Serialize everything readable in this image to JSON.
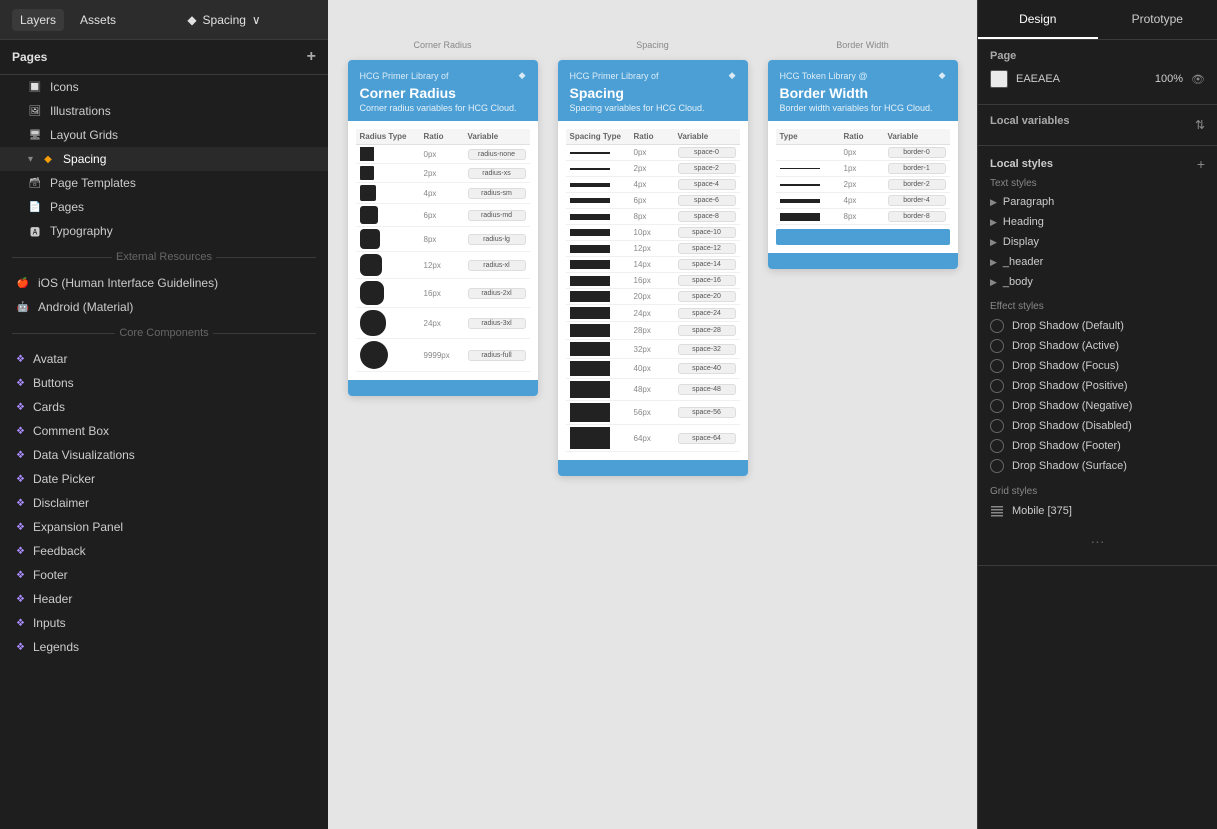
{
  "topbar": {
    "layers_tab": "Layers",
    "assets_tab": "Assets",
    "page_name": "Spacing",
    "page_indicator": "◆"
  },
  "pages_panel": {
    "title": "Pages",
    "add_icon": "+",
    "items": [
      {
        "id": "icons",
        "label": "Icons",
        "indent": 1,
        "icon": "🔲",
        "type": "page"
      },
      {
        "id": "illustrations",
        "label": "Illustrations",
        "indent": 1,
        "icon": "🖼",
        "type": "page"
      },
      {
        "id": "layout-grids",
        "label": "Layout Grids",
        "indent": 1,
        "icon": "🖥",
        "type": "page"
      },
      {
        "id": "spacing",
        "label": "Spacing",
        "indent": 1,
        "icon": "🔶",
        "type": "page",
        "active": true
      },
      {
        "id": "page-templates",
        "label": "Page Templates",
        "indent": 1,
        "icon": "🗃",
        "type": "page"
      },
      {
        "id": "pages",
        "label": "Pages",
        "indent": 1,
        "icon": "📄",
        "type": "page"
      },
      {
        "id": "typography",
        "label": "Typography",
        "indent": 1,
        "icon": "🅰",
        "type": "page"
      }
    ],
    "separator_external": "External Resources",
    "external_items": [
      {
        "id": "ios",
        "label": "iOS (Human Interface Guidelines)",
        "icon": "🍎"
      },
      {
        "id": "android",
        "label": "Android (Material)",
        "icon": "🤖"
      }
    ],
    "separator_core": "Core Components",
    "core_items": [
      {
        "id": "avatar",
        "label": "Avatar"
      },
      {
        "id": "buttons",
        "label": "Buttons"
      },
      {
        "id": "cards",
        "label": "Cards"
      },
      {
        "id": "comment-box",
        "label": "Comment Box"
      },
      {
        "id": "data-visualizations",
        "label": "Data Visualizations"
      },
      {
        "id": "date-picker",
        "label": "Date Picker"
      },
      {
        "id": "disclaimer",
        "label": "Disclaimer"
      },
      {
        "id": "expansion-panel",
        "label": "Expansion Panel"
      },
      {
        "id": "feedback",
        "label": "Feedback"
      },
      {
        "id": "footer",
        "label": "Footer"
      },
      {
        "id": "header",
        "label": "Header"
      },
      {
        "id": "inputs",
        "label": "Inputs"
      },
      {
        "id": "legends",
        "label": "Legends"
      }
    ]
  },
  "canvas": {
    "cards": [
      {
        "id": "corner-radius",
        "title": "Corner Radius",
        "brand": "HCG Primer Library of",
        "subtitle": "Corner radius variables for HCG Cloud.",
        "badge": "◆",
        "column_headers": [
          "Radius Type",
          "Ratio",
          "Variable"
        ],
        "rows": [
          {
            "swatch_size": 2,
            "label": "0px",
            "value": "radius-none"
          },
          {
            "swatch_size": 2,
            "label": "2px",
            "value": "radius-xs"
          },
          {
            "swatch_size": 4,
            "label": "4px",
            "value": "radius-sm"
          },
          {
            "swatch_size": 6,
            "label": "6px",
            "value": "radius-md"
          },
          {
            "swatch_size": 8,
            "label": "8px",
            "value": "radius-lg"
          },
          {
            "swatch_size": 12,
            "label": "12px",
            "value": "radius-xl"
          },
          {
            "swatch_size": 16,
            "label": "16px",
            "value": "radius-2xl"
          },
          {
            "swatch_size": 20,
            "label": "24px",
            "value": "radius-3xl"
          },
          {
            "swatch_size": 24,
            "label": "9999px",
            "value": "radius-full"
          }
        ]
      },
      {
        "id": "spacing",
        "title": "Spacing",
        "brand": "HCG Primer Library of",
        "subtitle": "Spacing variables for HCG Cloud.",
        "badge": "◆",
        "column_headers": [
          "Spacing Type",
          "Ratio",
          "Variable"
        ],
        "rows": [
          {
            "swatch_h": 2,
            "label": "0px",
            "value": "space-0"
          },
          {
            "swatch_h": 2,
            "label": "2px",
            "value": "space-2"
          },
          {
            "swatch_h": 4,
            "label": "4px",
            "value": "space-4"
          },
          {
            "swatch_h": 6,
            "label": "6px",
            "value": "space-6"
          },
          {
            "swatch_h": 8,
            "label": "8px",
            "value": "space-8"
          },
          {
            "swatch_h": 10,
            "label": "10px",
            "value": "space-10"
          },
          {
            "swatch_h": 12,
            "label": "12px",
            "value": "space-12"
          },
          {
            "swatch_h": 14,
            "label": "14px",
            "value": "space-14"
          },
          {
            "swatch_h": 16,
            "label": "16px",
            "value": "space-16"
          },
          {
            "swatch_h": 18,
            "label": "20px",
            "value": "space-20"
          },
          {
            "swatch_h": 20,
            "label": "24px",
            "value": "space-24"
          },
          {
            "swatch_h": 22,
            "label": "28px",
            "value": "space-28"
          },
          {
            "swatch_h": 24,
            "label": "32px",
            "value": "space-32"
          },
          {
            "swatch_h": 26,
            "label": "40px",
            "value": "space-40"
          },
          {
            "swatch_h": 28,
            "label": "48px",
            "value": "space-48"
          },
          {
            "swatch_h": 30,
            "label": "56px",
            "value": "space-56"
          },
          {
            "swatch_h": 32,
            "label": "64px",
            "value": "space-64"
          }
        ]
      },
      {
        "id": "border-width",
        "title": "Border Width",
        "brand": "HCG Token Library @",
        "subtitle": "Border width variables for HCG Cloud.",
        "badge": "◆",
        "column_headers": [
          "Type",
          "Ratio",
          "Variable"
        ],
        "rows": [
          {
            "border_h": 0,
            "label": "0px",
            "value": "border-0"
          },
          {
            "border_h": 1,
            "label": "1px",
            "value": "border-1"
          },
          {
            "border_h": 2,
            "label": "2px",
            "value": "border-2"
          },
          {
            "border_h": 3,
            "label": "4px",
            "value": "border-4"
          },
          {
            "border_h": 4,
            "label": "8px",
            "value": "border-8"
          }
        ]
      }
    ]
  },
  "right_panel": {
    "design_tab": "Design",
    "prototype_tab": "Prototype",
    "page_section": {
      "title": "Page",
      "color": "EAEAEA",
      "opacity": "100%"
    },
    "local_variables": {
      "title": "Local variables",
      "icon": "⇅"
    },
    "local_styles": {
      "title": "Local styles",
      "text_styles_title": "Text styles",
      "text_style_groups": [
        {
          "label": "Paragraph"
        },
        {
          "label": "Heading"
        },
        {
          "label": "Display"
        },
        {
          "label": "_header"
        },
        {
          "label": "_body"
        }
      ],
      "effect_styles_title": "Effect styles",
      "effect_styles": [
        {
          "label": "Drop Shadow (Default)"
        },
        {
          "label": "Drop Shadow (Active)"
        },
        {
          "label": "Drop Shadow (Focus)"
        },
        {
          "label": "Drop Shadow (Positive)"
        },
        {
          "label": "Drop Shadow (Negative)"
        },
        {
          "label": "Drop Shadow (Disabled)"
        },
        {
          "label": "Drop Shadow (Footer)"
        },
        {
          "label": "Drop Shadow (Surface)"
        }
      ],
      "grid_styles_title": "Grid styles",
      "grid_styles": [
        {
          "label": "Mobile [375]"
        }
      ]
    }
  }
}
